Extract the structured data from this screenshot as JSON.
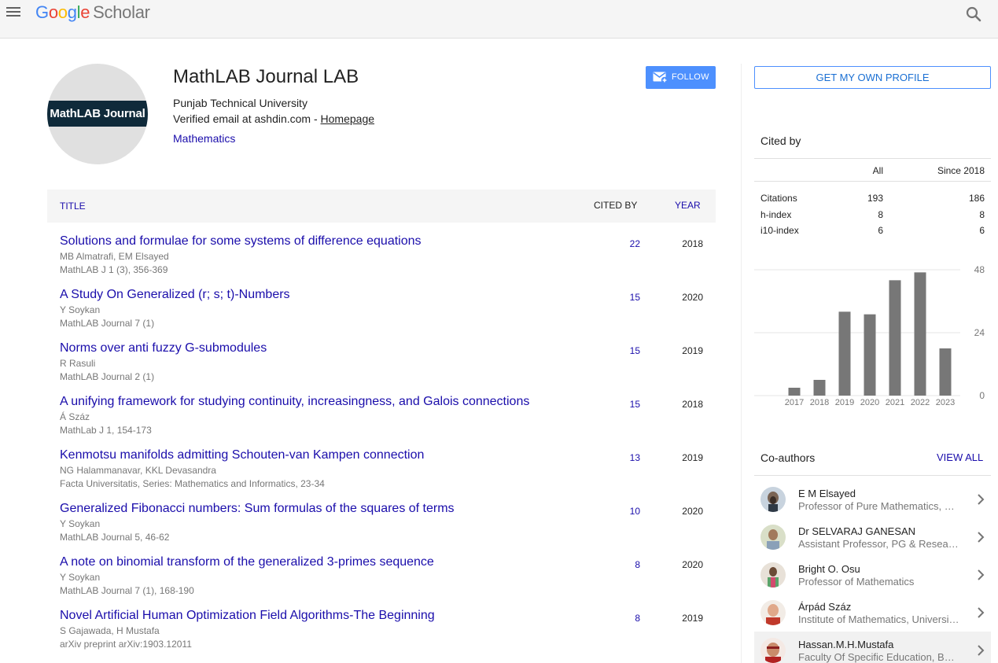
{
  "header": {
    "logo_google": [
      "G",
      "o",
      "o",
      "g",
      "l",
      "e"
    ],
    "logo_scholar": "Scholar"
  },
  "profile": {
    "avatar_text": "MathLAB Journal",
    "name": "MathLAB Journal LAB",
    "affiliation": "Punjab Technical University",
    "email_text": "Verified email at ashdin.com - ",
    "homepage_label": "Homepage",
    "interest": "Mathematics",
    "follow_label": "FOLLOW"
  },
  "table": {
    "col_title": "TITLE",
    "col_cited": "CITED BY",
    "col_year": "YEAR",
    "rows": [
      {
        "title": "Solutions and formulae for some systems of difference equations",
        "authors": "MB Almatrafi, EM Elsayed",
        "venue": "MathLAB J 1 (3), 356-369",
        "cited": "22",
        "year": "2018"
      },
      {
        "title": "A Study On Generalized (r; s; t)-Numbers",
        "authors": "Y Soykan",
        "venue": "MathLAB Journal 7 (1)",
        "cited": "15",
        "year": "2020"
      },
      {
        "title": "Norms over anti fuzzy G-submodules",
        "authors": "R Rasuli",
        "venue": "MathLAB Journal 2 (1)",
        "cited": "15",
        "year": "2019"
      },
      {
        "title": "A unifying framework for studying continuity, increasingness, and Galois connections",
        "authors": "Á Száz",
        "venue": "MathLab J 1, 154-173",
        "cited": "15",
        "year": "2018"
      },
      {
        "title": "Kenmotsu manifolds admitting Schouten-van Kampen connection",
        "authors": "NG Halammanavar, KKL Devasandra",
        "venue": "Facta Universitatis, Series: Mathematics and Informatics, 23-34",
        "cited": "13",
        "year": "2019"
      },
      {
        "title": "Generalized Fibonacci numbers: Sum formulas of the squares of terms",
        "authors": "Y Soykan",
        "venue": "MathLAB Journal 5, 46-62",
        "cited": "10",
        "year": "2020"
      },
      {
        "title": "A note on binomial transform of the generalized 3-primes sequence",
        "authors": "Y Soykan",
        "venue": "MathLAB Journal 7 (1), 168-190",
        "cited": "8",
        "year": "2020"
      },
      {
        "title": "Novel Artificial Human Optimization Field Algorithms-The Beginning",
        "authors": "S Gajawada, H Mustafa",
        "venue": "arXiv preprint arXiv:1903.12011",
        "cited": "8",
        "year": "2019"
      }
    ]
  },
  "sidebar": {
    "get_profile_label": "GET MY OWN PROFILE",
    "cited_by_title": "Cited by",
    "col_all": "All",
    "col_since": "Since 2018",
    "stats": [
      {
        "label": "Citations",
        "all": "193",
        "since": "186"
      },
      {
        "label": "h-index",
        "all": "8",
        "since": "8"
      },
      {
        "label": "i10-index",
        "all": "6",
        "since": "6"
      }
    ],
    "coauthors_title": "Co-authors",
    "view_all_label": "VIEW ALL",
    "coauthors": [
      {
        "name": "E M Elsayed",
        "affiliation": "Professor of Pure Mathematics, King Abdulaziz University"
      },
      {
        "name": "Dr SELVARAJ GANESAN",
        "affiliation": "Assistant Professor, PG & Research Department of Mathematics"
      },
      {
        "name": "Bright O. Osu",
        "affiliation": "Professor of Mathematics"
      },
      {
        "name": "Árpád Száz",
        "affiliation": "Institute of Mathematics, University of Debrecen"
      },
      {
        "name": "Hassan.M.H.Mustafa",
        "affiliation": "Faculty Of Specific Education, Banha University"
      }
    ]
  },
  "chart_data": {
    "type": "bar",
    "categories": [
      "2017",
      "2018",
      "2019",
      "2020",
      "2021",
      "2022",
      "2023"
    ],
    "values": [
      3,
      6,
      32,
      31,
      44,
      47,
      18
    ],
    "ylim": [
      0,
      48
    ],
    "yticks": [
      "0",
      "24",
      "48"
    ],
    "grid": true,
    "bar_color": "#777777"
  },
  "colors": {
    "link": "#1a0dab",
    "accent": "#4d90fe",
    "muted": "#777777"
  }
}
